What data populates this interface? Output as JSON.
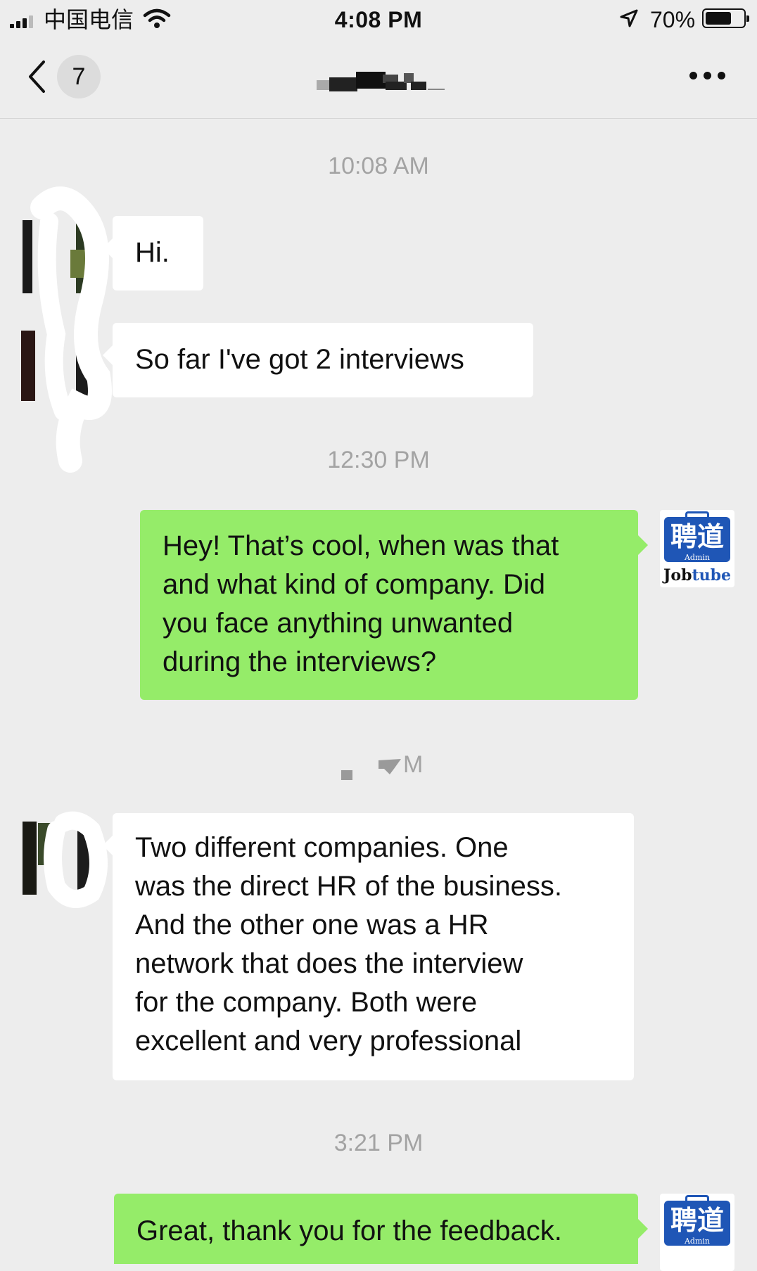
{
  "status_bar": {
    "carrier": "中国电信",
    "time": "4:08 PM",
    "battery": "70%",
    "battery_level": 0.7,
    "icons": [
      "signal-icon",
      "wifi-icon",
      "location-arrow-icon",
      "battery-icon"
    ]
  },
  "nav": {
    "unread_count": "7",
    "contact_name": "",
    "icons": [
      "back-chevron-icon",
      "more-icon"
    ]
  },
  "messages": [
    {
      "type": "timestamp",
      "text": "10:08 AM"
    },
    {
      "type": "incoming",
      "text": "Hi."
    },
    {
      "type": "incoming",
      "text": "So far I've got 2 interviews"
    },
    {
      "type": "timestamp",
      "text": "12:30 PM"
    },
    {
      "type": "outgoing",
      "lines": [
        "Hey! That’s cool, when was that",
        "and what kind of company. Did",
        "you face anything unwanted",
        "during the interviews?"
      ]
    },
    {
      "type": "timestamp",
      "text": "M"
    },
    {
      "type": "incoming",
      "lines": [
        "Two different companies. One",
        "was the direct HR of the business.",
        "And the other one was a HR",
        "network that does the interview",
        "for the company. Both were",
        "excellent and very professional"
      ]
    },
    {
      "type": "timestamp",
      "text": "3:21 PM"
    },
    {
      "type": "outgoing",
      "text": "Great, thank you for the feedback."
    }
  ],
  "admin_avatar": {
    "logo_text": "聘道",
    "role": "Admin",
    "brand_part1": "Job",
    "brand_part2": "tube",
    "brand_color": "#1f56b6"
  },
  "colors": {
    "background": "#ededed",
    "incoming_bubble": "#ffffff",
    "outgoing_bubble": "#95ec69",
    "timestamp_text": "#a3a3a3"
  }
}
